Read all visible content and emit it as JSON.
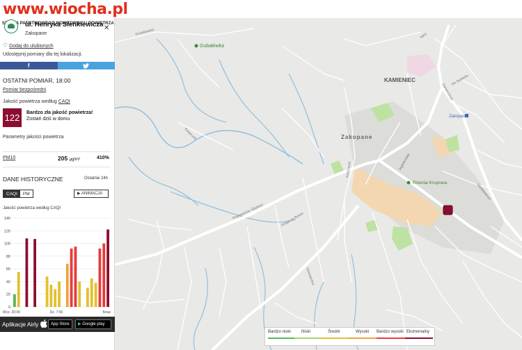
{
  "watermark": "www.wiocha.pl",
  "header_caption": "STACJA PAŃSTWOWEGO MONITORINGU POWIETRZA",
  "station": {
    "name": "ul. Henryka Sienkiewicza",
    "city": "Zakopane",
    "favorite_label": "Dodaj do ulubionych",
    "share_text": "Udostępnij pomiary dla tej lokalizacji.",
    "facebook_label": "f",
    "twitter_label": "t"
  },
  "measurement": {
    "title": "OSTATNI POMIAR, 18:00",
    "history_link": "Pomiar bezpośredni",
    "caqi_prefix": "Jakość powietrza według ",
    "caqi_link": "CAQI",
    "aqi_value": "122",
    "aqi_color": "#8b0d30",
    "verdict": "Bardzo zła jakość powietrza!",
    "advice": "Zostań dziś w domu",
    "params_title": "Parametry jakości powietrza",
    "pm_name": "PM10",
    "pm_value": "205",
    "pm_unit": "µg/m³",
    "pm_percent": "410%"
  },
  "history": {
    "title": "DANE HISTORYCZNE",
    "range": "Ostatnie 24h",
    "tabs": [
      "CAQI",
      "PM"
    ],
    "animation_label": "▶ ANIMACJA",
    "chart_caption": "Jakość powietrza według CAQI"
  },
  "chart_data": {
    "type": "bar",
    "ylim": [
      0,
      140
    ],
    "yticks": [
      0,
      20,
      40,
      60,
      80,
      100,
      120,
      140
    ],
    "xtick_labels": [
      "Wcz. 20:00",
      "Dz. 7:00",
      "Teraz"
    ],
    "values": [
      20,
      55,
      0,
      108,
      0,
      107,
      0,
      0,
      48,
      35,
      28,
      40,
      0,
      68,
      92,
      95,
      40,
      0,
      30,
      45,
      38,
      92,
      100,
      122
    ],
    "colors": [
      "#5ab55a",
      "#e2c02f",
      "#ffffff",
      "#8b0d30",
      "#ffffff",
      "#8b0d30",
      "#ffffff",
      "#ffffff",
      "#e2c02f",
      "#e2c02f",
      "#e2c02f",
      "#e2c02f",
      "#ffffff",
      "#f0a33a",
      "#e83a3a",
      "#e83a3a",
      "#e2c02f",
      "#ffffff",
      "#e2c02f",
      "#e2c02f",
      "#e2c02f",
      "#e83a3a",
      "#e83a3a",
      "#8b0d30"
    ]
  },
  "footer": {
    "app_label": "Aplikacje Airly",
    "app_store": "App Store",
    "google_play": "Google play"
  },
  "map": {
    "labels": [
      "Gubałówka",
      "KAMIENIEC",
      "Zakopane",
      "Równia Krupowa",
      "Zakopane"
    ],
    "streets": [
      "Gubałowska",
      "Powstańców Śląskich",
      "Droga na Bystre",
      "Kościuszki",
      "Jagiellońska",
      "Nowotarska",
      "Chramcówki",
      "Sienkiewicza",
      "Kasprusie",
      "Do Samków",
      "Tatry"
    ]
  },
  "legend": {
    "items": [
      "Bardzo niski",
      "Niski",
      "Średni",
      "Wysoki",
      "Bardzo wysoki",
      "Ekstremalny"
    ],
    "colors": [
      "#5ab55a",
      "#a6d36a",
      "#e2c02f",
      "#f0a33a",
      "#e83a3a",
      "#8b0d30"
    ]
  }
}
